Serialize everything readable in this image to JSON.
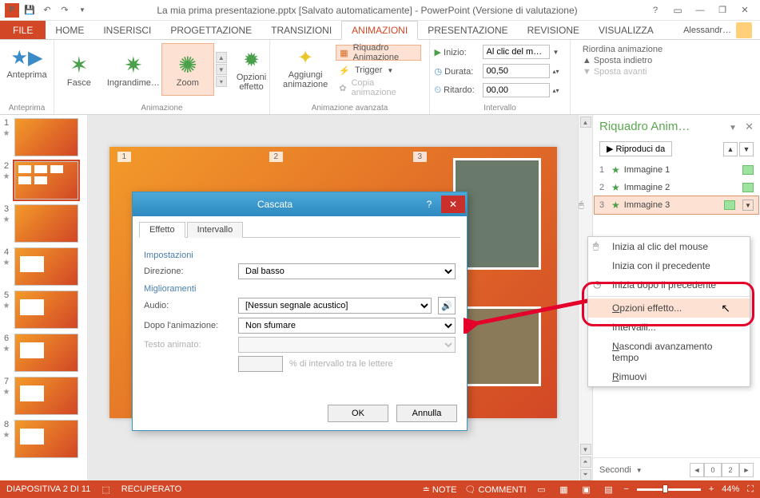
{
  "titlebar": {
    "title": "La mia prima presentazione.pptx [Salvato automaticamente] - PowerPoint (Versione di valutazione)"
  },
  "ribbon_tabs": {
    "file": "FILE",
    "tabs": [
      "HOME",
      "INSERISCI",
      "PROGETTAZIONE",
      "TRANSIZIONI",
      "ANIMAZIONI",
      "PRESENTAZIONE",
      "REVISIONE",
      "VISUALIZZA"
    ],
    "active_index": 4,
    "account": "Alessandr…"
  },
  "ribbon": {
    "preview": {
      "btn": "Anteprima",
      "group": "Anteprima"
    },
    "animations": {
      "items": [
        "Fasce",
        "Ingrandime…",
        "Zoom"
      ],
      "selected_index": 2,
      "options_btn": "Opzioni effetto",
      "group": "Animazione"
    },
    "advanced": {
      "add_btn": "Aggiungi animazione",
      "pane": "Riquadro Animazione",
      "trigger": "Trigger",
      "painter": "Copia animazione",
      "group": "Animazione avanzata"
    },
    "timing": {
      "start_label": "Inizio:",
      "start_value": "Al clic del m…",
      "duration_label": "Durata:",
      "duration_value": "00,50",
      "delay_label": "Ritardo:",
      "delay_value": "00,00",
      "group": "Intervallo"
    },
    "reorder": {
      "title": "Riordina animazione",
      "back": "Sposta indietro",
      "fwd": "Sposta avanti"
    }
  },
  "thumbnails": {
    "count": 8,
    "selected": 2
  },
  "anim_pane": {
    "title": "Riquadro Anim…",
    "play": "Riproduci da",
    "items": [
      {
        "idx": "1",
        "label": "Immagine 1"
      },
      {
        "idx": "2",
        "label": "Immagine 2"
      },
      {
        "idx": "3",
        "label": "Immagine 3"
      }
    ],
    "selected_index": 2,
    "seconds_label": "Secondi",
    "seconds_val": "0"
  },
  "context_menu": {
    "items": [
      "Inizia al clic del mouse",
      "Inizia con il precedente",
      "Inizia dopo il precedente",
      "Opzioni effetto...",
      "Intervalli...",
      "Nascondi avanzamento tempo",
      "Rimuovi"
    ],
    "highlight_index": 3
  },
  "dialog": {
    "title": "Cascata",
    "tabs": [
      "Effetto",
      "Intervallo"
    ],
    "active_tab": 0,
    "sections": {
      "settings": "Impostazioni",
      "enhance": "Miglioramenti"
    },
    "rows": {
      "direction_label": "Direzione:",
      "direction_value": "Dal basso",
      "audio_label": "Audio:",
      "audio_value": "[Nessun segnale acustico]",
      "after_label": "Dopo l'animazione:",
      "after_value": "Non sfumare",
      "text_label": "Testo animato:",
      "pct_label": "% di intervallo tra le lettere"
    },
    "ok": "OK",
    "cancel": "Annulla"
  },
  "status": {
    "slide": "DIAPOSITIVA 2 DI 11",
    "lang": "",
    "recovered": "RECUPERATO",
    "notes": "NOTE",
    "comments": "COMMENTI",
    "zoom": "44%"
  }
}
